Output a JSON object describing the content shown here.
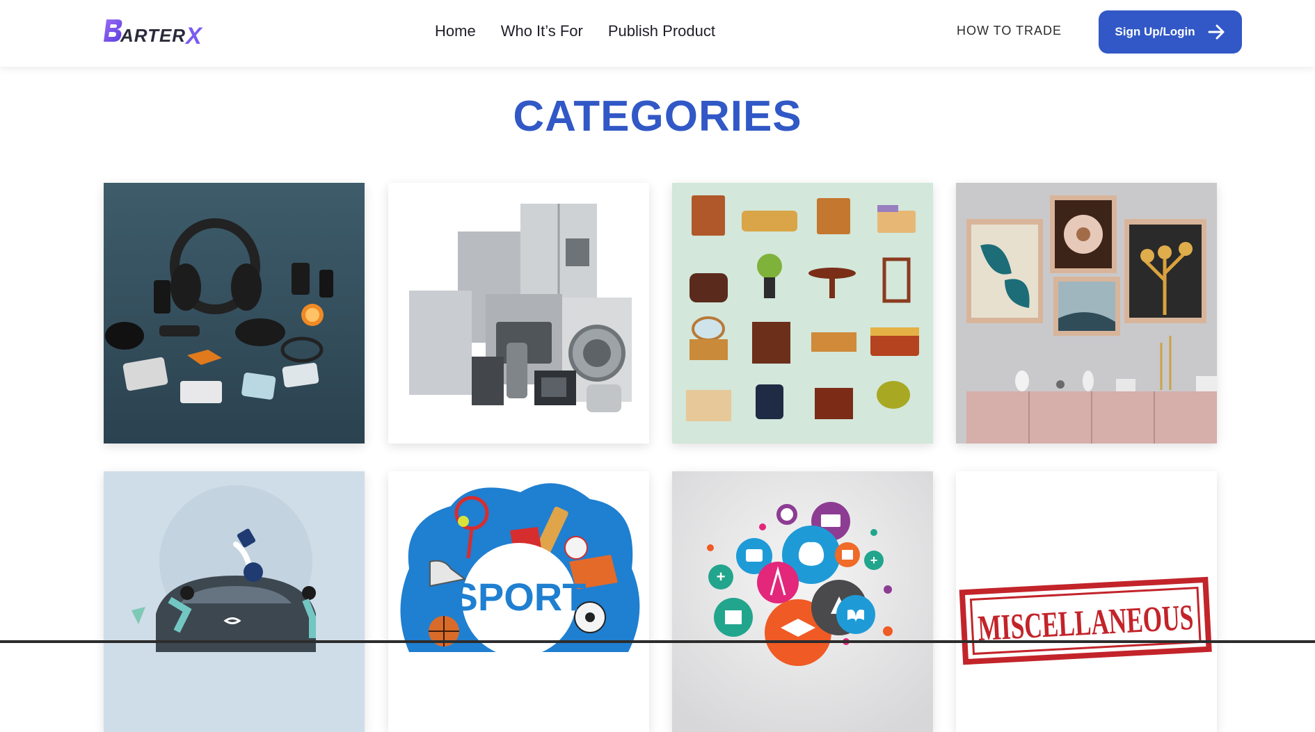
{
  "header": {
    "logo_text": "ARTER",
    "logo_x": "X",
    "nav": [
      "Home",
      "Who It’s For",
      "Publish Product"
    ],
    "how_to_trade": "HOW TO TRADE",
    "signup_label": "Sign Up/Login",
    "signup_icon": "arrow-right-icon"
  },
  "main": {
    "title": "CATEGORIES",
    "categories": [
      {
        "name": "electronics",
        "image_text": ""
      },
      {
        "name": "home-appliances",
        "image_text": ""
      },
      {
        "name": "furniture",
        "image_text": ""
      },
      {
        "name": "home-decor",
        "image_text": ""
      },
      {
        "name": "vehicles",
        "image_text": ""
      },
      {
        "name": "sports",
        "image_text": "SPORT"
      },
      {
        "name": "education",
        "image_text": ""
      },
      {
        "name": "miscellaneous",
        "image_text": "MISCELLANEOUS"
      }
    ]
  },
  "colors": {
    "accent": "#3158c6",
    "logo_purple": "#7b5cf0"
  }
}
